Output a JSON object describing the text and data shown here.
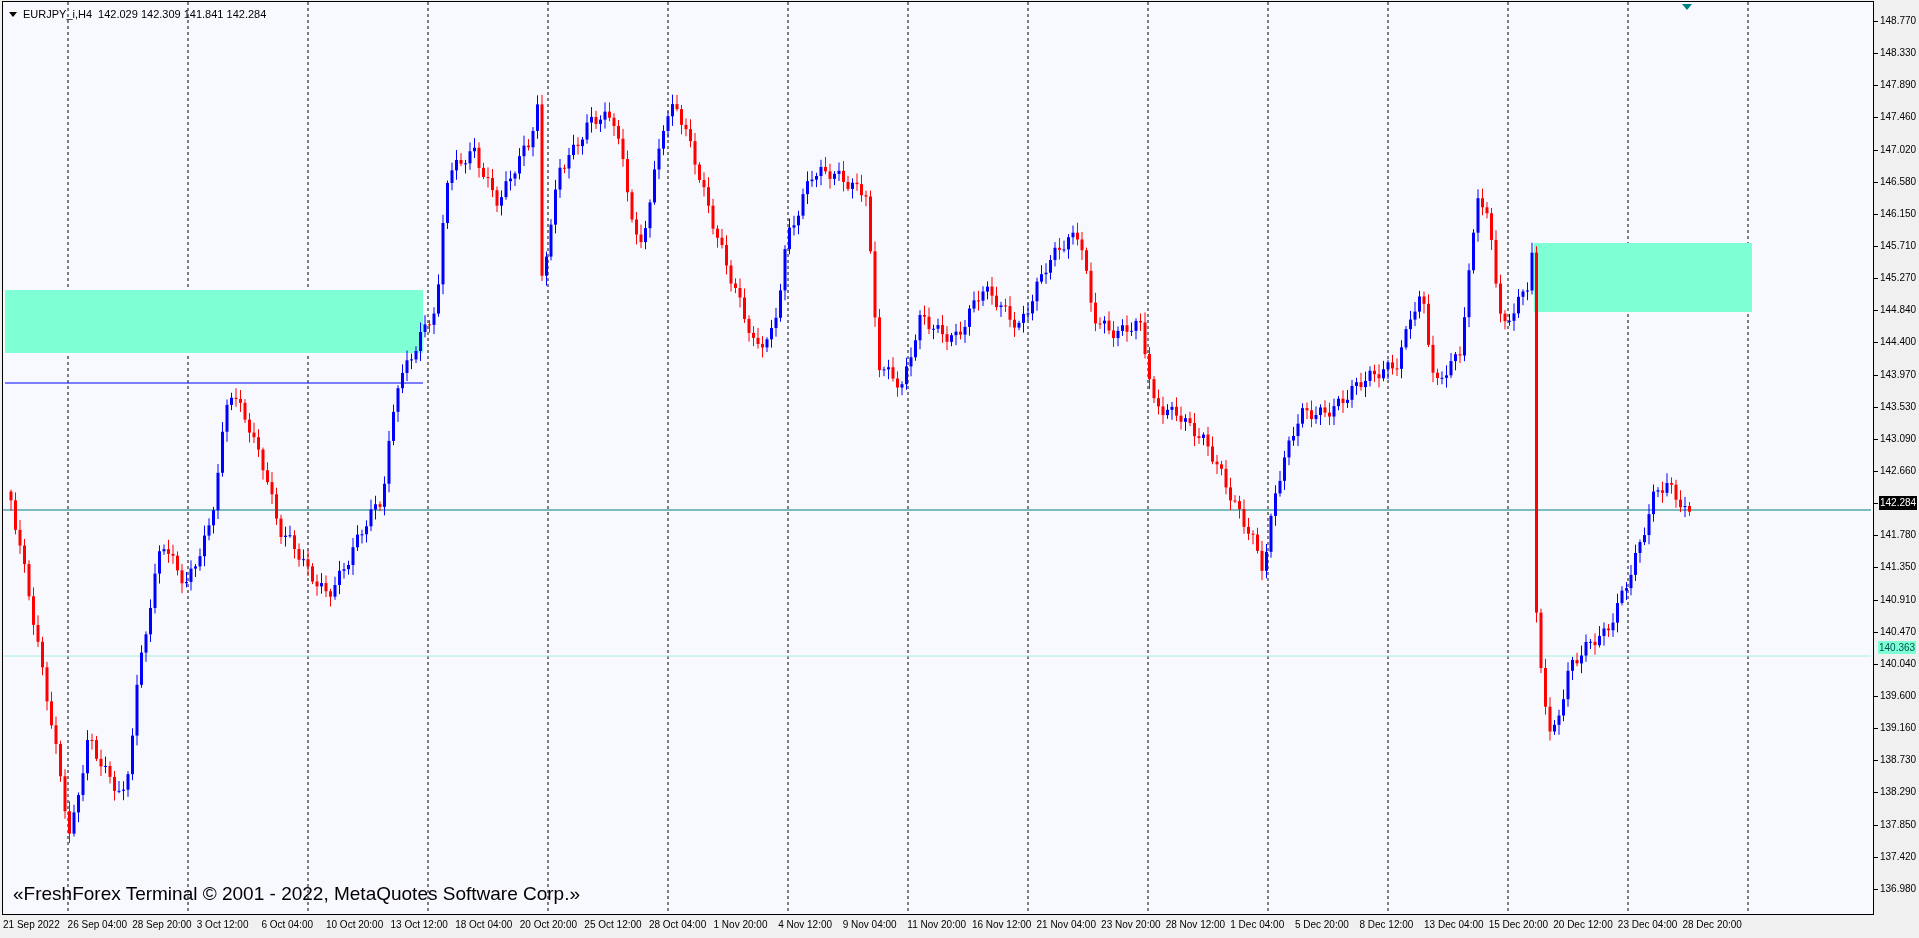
{
  "header": {
    "symbol": "EURJPY_i,H4",
    "ohlc": "142.029 142.309 141.841 142.284"
  },
  "price_axis": [
    {
      "kind": "tick",
      "text": "148.770"
    },
    {
      "kind": "tick",
      "text": "148.330"
    },
    {
      "kind": "tick",
      "text": "147.890"
    },
    {
      "kind": "tick",
      "text": "147.460"
    },
    {
      "kind": "tick",
      "text": "147.020"
    },
    {
      "kind": "tick",
      "text": "146.580"
    },
    {
      "kind": "tick",
      "text": "146.150"
    },
    {
      "kind": "tick",
      "text": "145.710"
    },
    {
      "kind": "tick",
      "text": "145.270"
    },
    {
      "kind": "tick",
      "text": "144.840"
    },
    {
      "kind": "tick",
      "text": "144.400"
    },
    {
      "kind": "tick",
      "text": "143.970"
    },
    {
      "kind": "tick",
      "text": "143.530"
    },
    {
      "kind": "tick",
      "text": "143.090"
    },
    {
      "kind": "tick",
      "text": "142.660"
    },
    {
      "kind": "tag",
      "text": "142.284",
      "color": "#000000"
    },
    {
      "kind": "tick",
      "text": "141.780"
    },
    {
      "kind": "tick",
      "text": "141.350"
    },
    {
      "kind": "tick",
      "text": "140.910"
    },
    {
      "kind": "tick",
      "text": "140.470"
    },
    {
      "kind": "tick",
      "text": "140.040"
    },
    {
      "kind": "tick",
      "text": "139.600"
    },
    {
      "kind": "tick",
      "text": "139.160"
    },
    {
      "kind": "tick",
      "text": "138.730"
    },
    {
      "kind": "tick",
      "text": "138.290"
    },
    {
      "kind": "tick",
      "text": "137.850"
    },
    {
      "kind": "tick",
      "text": "137.420"
    },
    {
      "kind": "tick",
      "text": "136.980"
    }
  ],
  "level_tag": {
    "text": "140.363",
    "color": "#7fffd4"
  },
  "time_axis": [
    "21 Sep 2022",
    "26 Sep 04:00",
    "28 Sep 20:00",
    "3 Oct 12:00",
    "6 Oct 04:00",
    "10 Oct 20:00",
    "13 Oct 12:00",
    "18 Oct 04:00",
    "20 Oct 20:00",
    "25 Oct 12:00",
    "28 Oct 04:00",
    "1 Nov 20:00",
    "4 Nov 12:00",
    "9 Nov 04:00",
    "11 Nov 20:00",
    "16 Nov 12:00",
    "21 Nov 04:00",
    "23 Nov 20:00",
    "28 Nov 12:00",
    "1 Dec 04:00",
    "5 Dec 20:00",
    "8 Dec 12:00",
    "13 Dec 04:00",
    "15 Dec 20:00",
    "20 Dec 12:00",
    "23 Dec 04:00",
    "28 Dec 20:00"
  ],
  "copyright": "«FreshForex Terminal © 2001 - 2022, MetaQuotes Software Corp.»"
}
